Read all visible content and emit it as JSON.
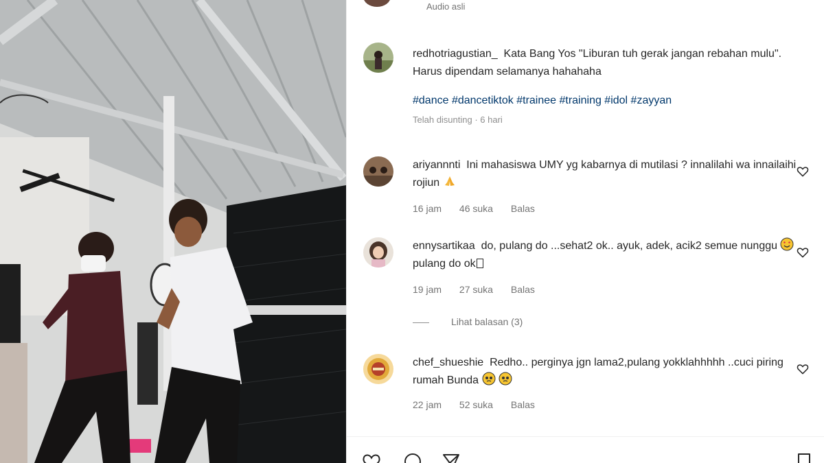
{
  "audio": {
    "label": "Audio asli"
  },
  "caption": {
    "username": "redhotriagustian_",
    "text": "Kata Bang Yos \"Liburan tuh gerak jangan rebahan mulu\". Harus dipendam selamanya hahahaha",
    "hashtags": "#dance #dancetiktok #trainee #training #idol #zayyan",
    "meta": "Telah disunting · 6 hari"
  },
  "comments": [
    {
      "username": "ariyannnti",
      "text": "Ini mahasiswa UMY yg kabarnya di mutilasi ? innalilahi wa innailaihi rojiun",
      "emoji": "praying-hands",
      "time": "16 jam",
      "likes": "46 suka",
      "reply": "Balas"
    },
    {
      "username": "ennysartikaa",
      "text": "do, pulang do ...sehat2 ok.. ayuk, adek, acik2 semue nunggu",
      "text_after": "pulang do ok",
      "emoji": "smiling-face-with-heart-eyes",
      "time": "19 jam",
      "likes": "27 suka",
      "reply": "Balas"
    },
    {
      "username": "chef_shueshie",
      "text": "Redho.. perginya jgn lama2,pulang yokklahhhhh ..cuci piring rumah Bunda",
      "emoji": "pleading-face",
      "time": "22 jam",
      "likes": "52 suka",
      "reply": "Balas"
    }
  ],
  "view_replies": "Lihat balasan (3)",
  "icons": {
    "like": "heart-icon",
    "comment": "comment-icon",
    "share": "paper-plane-icon",
    "save": "bookmark-icon"
  },
  "colors": {
    "hashtag": "#00376b",
    "meta": "#737373",
    "text": "#262626"
  }
}
